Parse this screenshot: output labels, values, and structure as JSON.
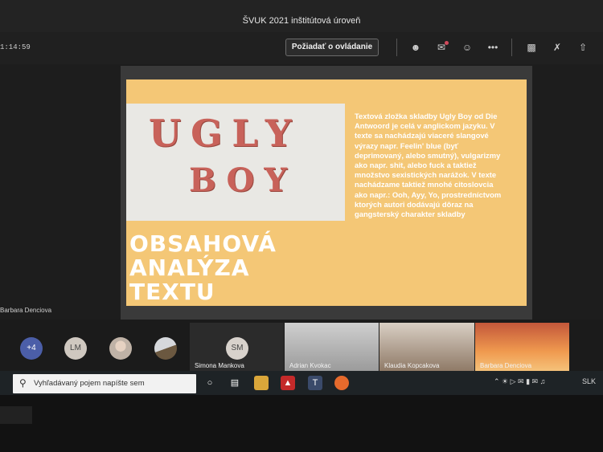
{
  "window": {
    "title": "ŠVUK 2021 inštitútová úroveň"
  },
  "toolbar": {
    "timer": "1:14:59",
    "request_control_label": "Požiadať o ovládanie",
    "icons": [
      "participants-icon",
      "chat-icon",
      "reactions-icon",
      "more-icon",
      "camera-off-icon",
      "mic-off-icon",
      "share-icon"
    ]
  },
  "slide": {
    "image_word1": "UGLY",
    "image_word2": "BOY",
    "description": "Textová zložka skladby Ugly Boy od Die Antwoord je celá v anglickom jazyku. V texte sa nachádzajú viaceré slangové výrazy napr. Feelin' blue (byť deprimovaný, alebo smutný), vulgarizmy ako napr. shit, alebo fuck a taktiež množstvo sexistických narážok. V texte nachádzame taktiež mnohé citoslovcia ako napr.: Ooh, Ayy, Yo, prostredníctvom ktorých autori dodávajú dôraz na gangsterský charakter skladby",
    "heading_line1": "OBSAHOVÁ",
    "heading_line2": "ANALÝZA",
    "heading_line3": "TEXTU",
    "presenter_label": "Barbara Denciova",
    "colors": {
      "background": "#f4c776",
      "text": "#ffffff",
      "image_letters": "#c8625a"
    }
  },
  "participants": {
    "overflow_count": "+4",
    "avatar_lm": "LM",
    "tiles": [
      {
        "initials": "SM",
        "name": "Simona Mankova"
      },
      {
        "name": "Adrian Kvokac"
      },
      {
        "name": "Klaudia Kopcakova"
      },
      {
        "name": "Barbara Denciova"
      }
    ]
  },
  "taskbar": {
    "search_placeholder": "Vyhľadávaný pojem napíšte sem",
    "apps": [
      "task-view-icon",
      "file-explorer-icon",
      "acrobat-icon",
      "teams-icon",
      "firefox-icon"
    ],
    "language": "SLK"
  }
}
